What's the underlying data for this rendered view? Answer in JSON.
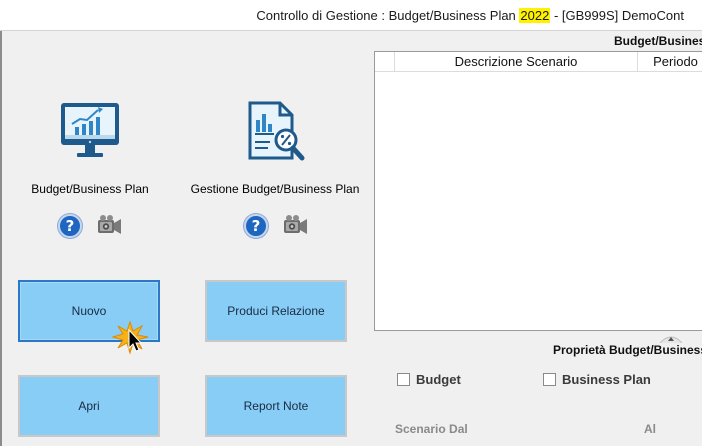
{
  "window": {
    "title_prefix": "Controllo di Gestione : Budget/Business Plan ",
    "title_year": "2022",
    "title_suffix": " - [GB999S] DemoCont"
  },
  "modules": [
    {
      "label": "Budget/Business Plan",
      "icon": "monitor-chart-icon"
    },
    {
      "label": "Gestione Budget/Business Plan",
      "icon": "document-analysis-icon"
    }
  ],
  "help_glyph": "?",
  "buttons": {
    "nuovo": "Nuovo",
    "produci_relazione": "Produci Relazione",
    "apri": "Apri",
    "report_note": "Report Note"
  },
  "scenarios_panel": {
    "title": "Budget/Business",
    "columns": [
      "Descrizione Scenario",
      "Periodo"
    ],
    "rows": []
  },
  "properties_panel": {
    "title": "Proprietà Budget/Business",
    "checkboxes": [
      {
        "label": "Budget",
        "checked": false
      },
      {
        "label": "Business Plan",
        "checked": false
      }
    ],
    "scenario_dal_label": "Scenario Dal",
    "al_label": "Al"
  },
  "colors": {
    "button_fill": "#87cdf5",
    "active_border": "#2b78c9",
    "year_highlight": "#fff200",
    "help_blue": "#1f66c1"
  }
}
